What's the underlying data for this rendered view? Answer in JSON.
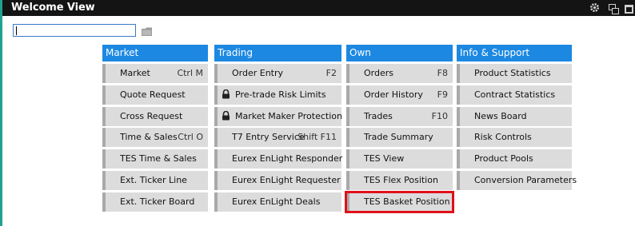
{
  "window": {
    "title": "Welcome View"
  },
  "search": {
    "value": "",
    "placeholder": ""
  },
  "columns": [
    {
      "title": "Market",
      "items": [
        {
          "label": "Market",
          "shortcut": "Ctrl M"
        },
        {
          "label": "Quote Request",
          "shortcut": ""
        },
        {
          "label": "Cross Request",
          "shortcut": ""
        },
        {
          "label": "Time & Sales",
          "shortcut": "Ctrl O"
        },
        {
          "label": "TES Time & Sales",
          "shortcut": ""
        },
        {
          "label": "Ext. Ticker Line",
          "shortcut": ""
        },
        {
          "label": "Ext. Ticker Board",
          "shortcut": ""
        }
      ]
    },
    {
      "title": "Trading",
      "items": [
        {
          "label": "Order Entry",
          "shortcut": "F2"
        },
        {
          "label": "Pre-trade Risk Limits",
          "shortcut": "",
          "locked": true
        },
        {
          "label": "Market Maker Protection",
          "shortcut": "",
          "locked": true
        },
        {
          "label": "T7 Entry Service",
          "shortcut": "Shift F11"
        },
        {
          "label": "Eurex EnLight Responder",
          "shortcut": ""
        },
        {
          "label": "Eurex EnLight Requester",
          "shortcut": ""
        },
        {
          "label": "Eurex EnLight Deals",
          "shortcut": ""
        }
      ]
    },
    {
      "title": "Own",
      "items": [
        {
          "label": "Orders",
          "shortcut": "F8"
        },
        {
          "label": "Order History",
          "shortcut": "F9"
        },
        {
          "label": "Trades",
          "shortcut": "F10"
        },
        {
          "label": "Trade Summary",
          "shortcut": ""
        },
        {
          "label": "TES View",
          "shortcut": ""
        },
        {
          "label": "TES Flex Position",
          "shortcut": ""
        },
        {
          "label": "TES Basket Position",
          "shortcut": "",
          "highlighted": true
        }
      ]
    },
    {
      "title": "Info & Support",
      "items": [
        {
          "label": "Product Statistics",
          "shortcut": ""
        },
        {
          "label": "Contract Statistics",
          "shortcut": ""
        },
        {
          "label": "News Board",
          "shortcut": ""
        },
        {
          "label": "Risk Controls",
          "shortcut": ""
        },
        {
          "label": "Product Pools",
          "shortcut": ""
        },
        {
          "label": "Conversion Parameters",
          "shortcut": ""
        }
      ]
    }
  ],
  "colors": {
    "header": "#1c88e2",
    "highlight": "#e0101a",
    "titlebar": "#141414"
  },
  "icons": {
    "settings": "gear-icon",
    "restore": "restore-window-icon",
    "maximize": "maximize-icon",
    "open": "folder-icon",
    "lock": "lock-icon"
  }
}
